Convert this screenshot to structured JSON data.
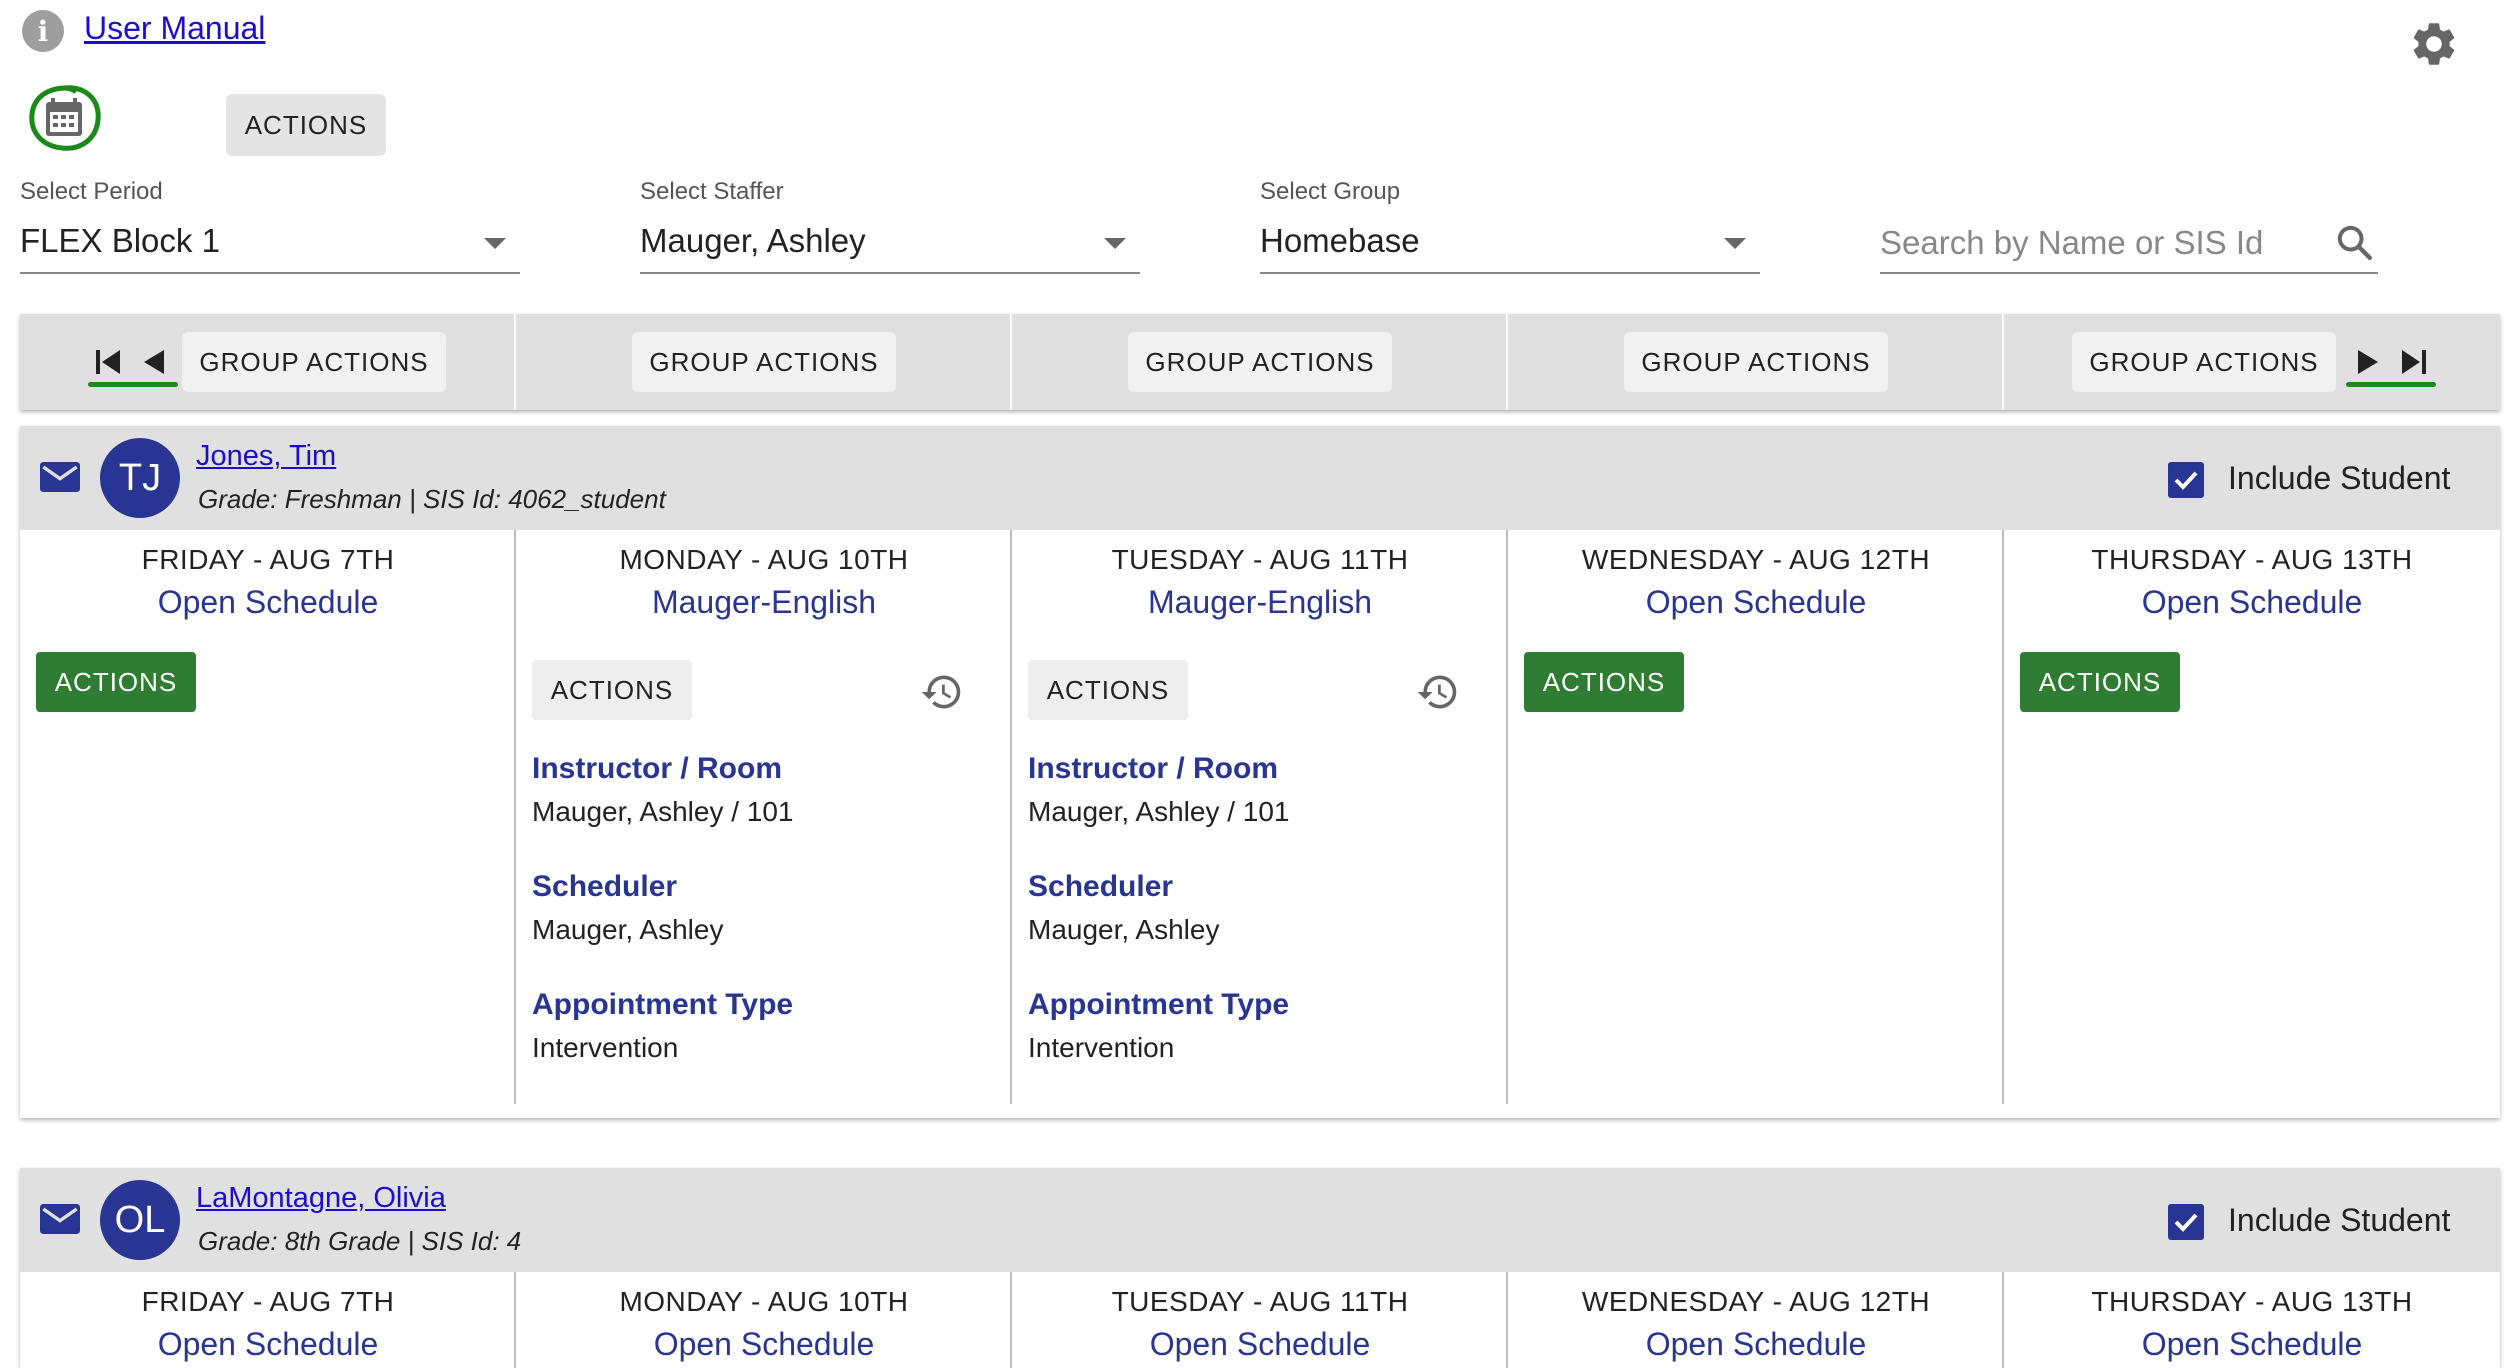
{
  "header": {
    "manual_link": "User Manual",
    "actions_label": "ACTIONS"
  },
  "icons": {
    "info": "info-icon",
    "settings": "gear-icon",
    "calendar": "calendar-icon",
    "search": "search-icon",
    "mail": "mail-icon",
    "history": "history-icon"
  },
  "filters": {
    "period": {
      "label": "Select Period",
      "value": "FLEX Block 1"
    },
    "staffer": {
      "label": "Select Staffer",
      "value": "Mauger, Ashley"
    },
    "group": {
      "label": "Select Group",
      "value": "Homebase"
    },
    "search": {
      "placeholder": "Search by Name or SIS Id"
    }
  },
  "group_actions": [
    "GROUP ACTIONS",
    "GROUP ACTIONS",
    "GROUP ACTIONS",
    "GROUP ACTIONS",
    "GROUP ACTIONS"
  ],
  "colors": {
    "green": "#2e7d32",
    "navy": "#283593",
    "link": "#1a0dcc",
    "highlight_circle": "#1b8a1b"
  },
  "students": [
    {
      "initials": "TJ",
      "name": "Jones, Tim",
      "meta": "Grade: Freshman  |  SIS Id: 4062_student",
      "include_label": "Include Student",
      "include_checked": true,
      "days": [
        {
          "title": "FRIDAY - AUG 7TH",
          "schedule": "Open Schedule",
          "actions": "ACTIONS"
        },
        {
          "title": "MONDAY - AUG 10TH",
          "schedule": "Mauger-English",
          "actions": "ACTIONS",
          "instructor_label": "Instructor / Room",
          "instructor": "Mauger, Ashley / 101",
          "scheduler_label": "Scheduler",
          "scheduler": "Mauger, Ashley",
          "type_label": "Appointment Type",
          "type": "Intervention"
        },
        {
          "title": "TUESDAY - AUG 11TH",
          "schedule": "Mauger-English",
          "actions": "ACTIONS",
          "instructor_label": "Instructor / Room",
          "instructor": "Mauger, Ashley / 101",
          "scheduler_label": "Scheduler",
          "scheduler": "Mauger, Ashley",
          "type_label": "Appointment Type",
          "type": "Intervention"
        },
        {
          "title": "WEDNESDAY - AUG 12TH",
          "schedule": "Open Schedule",
          "actions": "ACTIONS"
        },
        {
          "title": "THURSDAY - AUG 13TH",
          "schedule": "Open Schedule",
          "actions": "ACTIONS"
        }
      ]
    },
    {
      "initials": "OL",
      "name": "LaMontagne, Olivia",
      "meta": "Grade: 8th Grade  |  SIS Id: 4",
      "include_label": "Include Student",
      "include_checked": true,
      "days": [
        {
          "title": "FRIDAY - AUG 7TH",
          "schedule": "Open Schedule"
        },
        {
          "title": "MONDAY - AUG 10TH",
          "schedule": "Open Schedule"
        },
        {
          "title": "TUESDAY - AUG 11TH",
          "schedule": "Open Schedule"
        },
        {
          "title": "WEDNESDAY - AUG 12TH",
          "schedule": "Open Schedule"
        },
        {
          "title": "THURSDAY - AUG 13TH",
          "schedule": "Open Schedule"
        }
      ]
    }
  ]
}
